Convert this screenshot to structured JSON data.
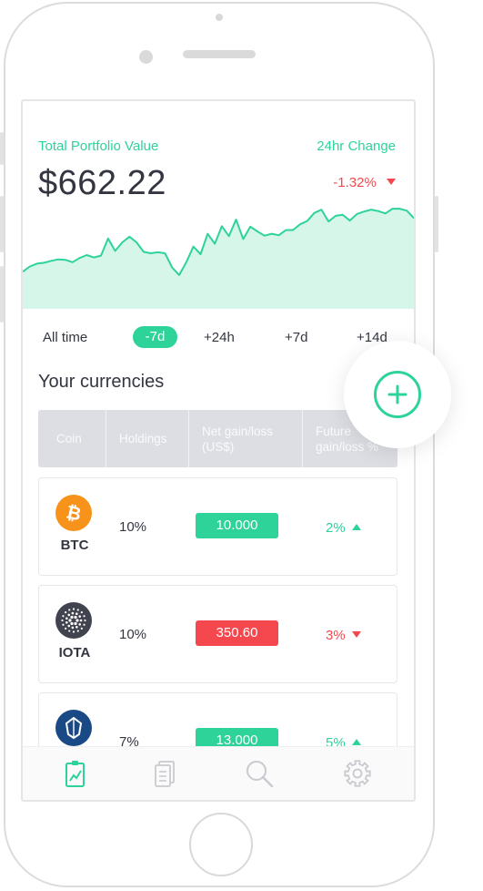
{
  "portfolio": {
    "title": "Total Portfolio Value",
    "value": "$662.22",
    "change_title": "24hr Change",
    "change_value": "-1.32%"
  },
  "time_ranges": [
    "All time",
    "-7d",
    "+24h",
    "+7d",
    "+14d"
  ],
  "active_range": "-7d",
  "section_title": "Your currencies",
  "table": {
    "headers": [
      "Coin",
      "Holdings",
      "Net gain/loss (US$)",
      "Future gain/loss %"
    ],
    "rows": [
      {
        "coin": "BTC",
        "holdings": "10%",
        "net": "10.000",
        "future": "2%",
        "trend": "up"
      },
      {
        "coin": "IOTA",
        "holdings": "10%",
        "net": "350.60",
        "future": "3%",
        "trend": "down"
      },
      {
        "coin": "",
        "holdings": "7%",
        "net": "13.000",
        "future": "5%",
        "trend": "up"
      }
    ]
  },
  "nav": {
    "items": [
      "portfolio-icon",
      "documents-icon",
      "search-icon",
      "settings-icon"
    ],
    "active": "portfolio-icon"
  },
  "colors": {
    "accent_green": "#2ed39a",
    "negative_red": "#f5484e",
    "chart_fill": "#d6f6ea",
    "btc_orange": "#f7931a",
    "iota_dark": "#41434f",
    "third_coin_blue": "#1a4a86"
  },
  "chart_data": {
    "type": "area",
    "series": [
      {
        "values": [
          0.63,
          0.74,
          0.8,
          0.82,
          0.86,
          0.89,
          0.88,
          0.83,
          0.92,
          0.98,
          0.93,
          0.97,
          1.33,
          1.07,
          1.25,
          1.37,
          1.25,
          1.05,
          1.02,
          1.04,
          1.02,
          0.72,
          0.56,
          0.83,
          1.16,
          1.0,
          1.43,
          1.22,
          1.59,
          1.38,
          1.73,
          1.32,
          1.58,
          1.48,
          1.39,
          1.43,
          1.4,
          1.51,
          1.51,
          1.63,
          1.7,
          1.87,
          1.94,
          1.69,
          1.81,
          1.83,
          1.71,
          1.85,
          1.9,
          1.94,
          1.91,
          1.86,
          1.96,
          1.96,
          1.92,
          1.76
        ]
      }
    ]
  }
}
